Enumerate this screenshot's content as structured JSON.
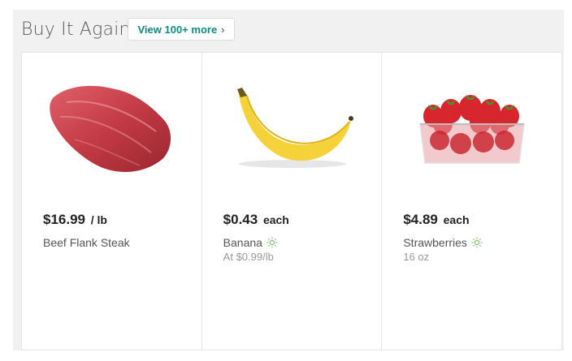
{
  "section": {
    "title": "Buy It Again",
    "view_more_label": "View 100+ more",
    "accent_color": "#0b8a84"
  },
  "products": [
    {
      "price": "$16.99",
      "unit": "/ lb",
      "name": "Beef Flank Steak",
      "detail": "",
      "image": "beef-steak-image",
      "icon": ""
    },
    {
      "price": "$0.43",
      "unit": "each",
      "name": "Banana",
      "detail": "At $0.99/lb",
      "image": "banana-image",
      "icon": "sun-icon"
    },
    {
      "price": "$4.89",
      "unit": "each",
      "name": "Strawberries",
      "detail": "16 oz",
      "image": "strawberries-image",
      "icon": "sun-icon"
    }
  ]
}
